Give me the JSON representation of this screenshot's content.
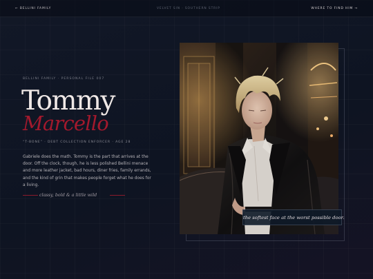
{
  "nav": {
    "left": "← BELLINI FAMILY",
    "center": "VELVET SIN · SOUTHERN STRIP",
    "right": "WHERE TO FIND HIM →"
  },
  "profile": {
    "kicker": "BELLINI FAMILY · PERSONAL FILE 007",
    "first_name": "Tommy",
    "last_name": "Marcello",
    "subtitle": "“T-BONE” · DEBT COLLECTION ENFORCER · AGE 28",
    "bio": "Gabriele does the math. Tommy is the part that arrives at the door. Off the clock, though, he is less polished Bellini menace and more leather jacket, bad hours, diner fries, family errands, and the kind of grin that makes people forget what he does for a living.",
    "tagline": "classy, bold & a little wild"
  },
  "photo": {
    "caption": "the softest face at the worst possible door."
  },
  "colors": {
    "accent": "#a3192d",
    "background": "#121827",
    "text": "#efe8e6"
  }
}
